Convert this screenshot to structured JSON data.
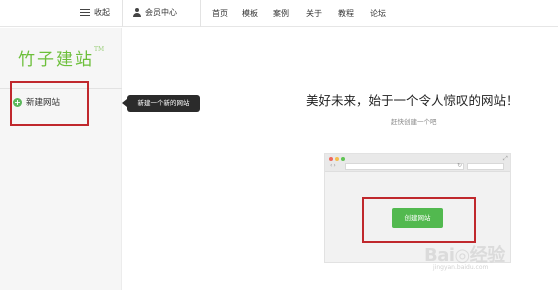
{
  "topbar": {
    "collapse_label": "收起",
    "member_label": "会员中心",
    "nav": [
      "首页",
      "模板",
      "案例",
      "关于",
      "教程",
      "论坛"
    ]
  },
  "sidebar": {
    "logo": "竹子建站",
    "logo_tm": "TM",
    "new_site_label": "新建网站"
  },
  "tooltip": "新建一个新的网站",
  "main": {
    "headline": "美好未来，始于一个令人惊叹的网站！",
    "subline": "赶快创建一个吧",
    "create_button": "创建网站"
  },
  "watermark": {
    "brand": "Bai◎经验",
    "url": "jingyan.baidu.com"
  },
  "colors": {
    "accent_green": "#52b94f",
    "logo_green": "#6cbf3a",
    "highlight_red": "#c0282d"
  }
}
